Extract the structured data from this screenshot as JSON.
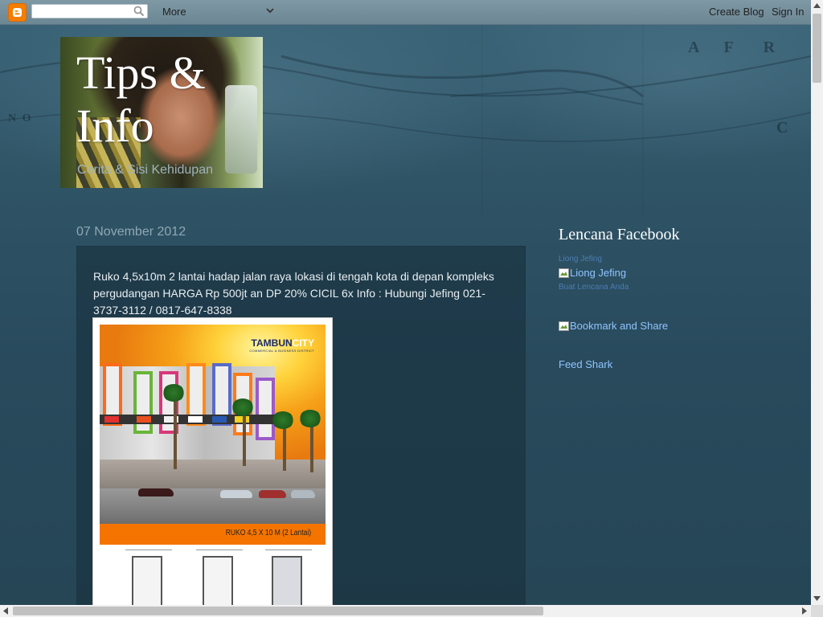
{
  "navbar": {
    "more_label": "More",
    "create_blog": "Create Blog",
    "sign_in": "Sign In",
    "search_placeholder": ""
  },
  "header": {
    "title": "Tips & Info",
    "description": "Cerita & Sisi Kehidupan"
  },
  "post": {
    "date": "07 November 2012",
    "body": "Ruko 4,5x10m 2 lantai hadap jalan raya lokasi di tengah kota di depan kompleks pergudangan HARGA Rp 500jt an DP 20% CICIL 6x Info : Hubungi Jefing 021-3737-3112 / 0817-647-8338",
    "image": {
      "logo_main": "TAMBUN",
      "logo_accent": "CITY",
      "logo_sub": "COMMERCIAL & BUSINESS DISTRICT",
      "caption": "RUKO 4,5 X 10 M (2 Lantai)"
    }
  },
  "sidebar": {
    "badge_title": "Lencana Facebook",
    "badge_owner_link": "Liong Jefing",
    "badge_image_alt": "Liong Jefing",
    "badge_create_link": "Buat Lencana Anda",
    "bookmark_alt": "Bookmark and Share",
    "feed_link": "Feed Shark"
  },
  "colors": {
    "accent_orange": "#f57d00",
    "link_blue": "#8fc4ff",
    "small_link_blue": "#4b7db3"
  }
}
